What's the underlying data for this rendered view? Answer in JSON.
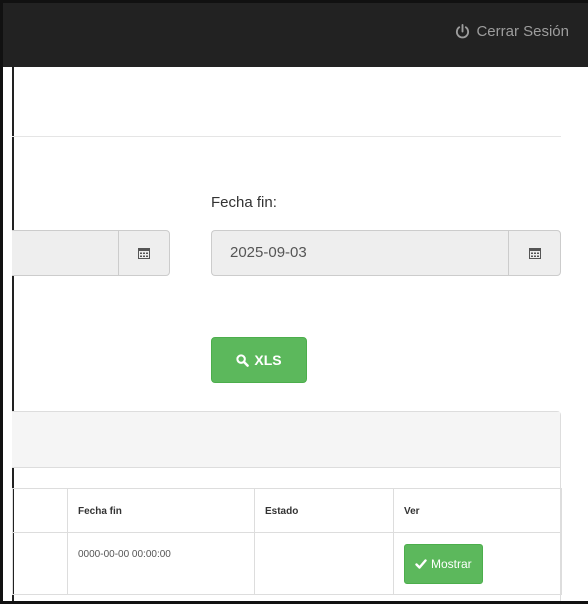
{
  "navbar": {
    "logout_label": "Cerrar Sesión"
  },
  "form": {
    "end_date_label": "Fecha fin:",
    "end_date_value": "2025-09-03",
    "xls_button": "XLS"
  },
  "table": {
    "headers": [
      "",
      "Fecha fin",
      "Estado",
      "Ver"
    ],
    "rows": [
      {
        "end_date": "0000-00-00 00:00:00",
        "status": "",
        "action": "Mostrar"
      }
    ]
  },
  "colors": {
    "navbar": "#222222",
    "success": "#5cb85c",
    "panel": "#f5f5f5"
  }
}
